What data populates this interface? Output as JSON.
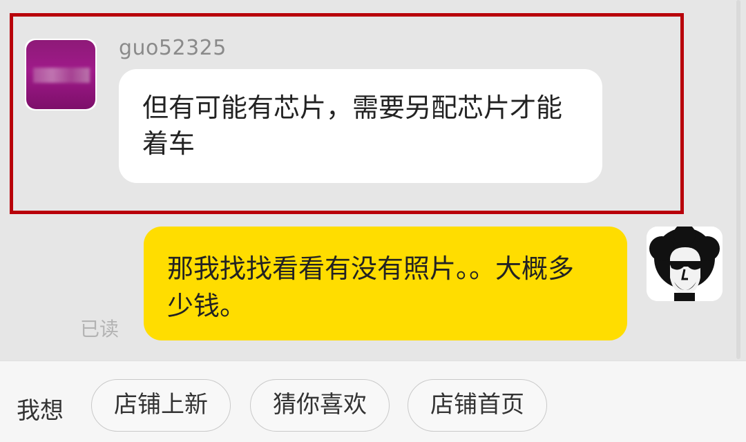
{
  "messages": [
    {
      "direction": "incoming",
      "sender": "guo52325",
      "text": "但有可能有芯片，需要另配芯片才能着车",
      "bubble_color": "#ffffff"
    },
    {
      "direction": "outgoing",
      "text": "那我找找看看有没有照片。。大概多少钱。",
      "status": "已读",
      "bubble_color": "#ffdd00"
    }
  ],
  "highlight_color": "#b8000a",
  "suggestions": {
    "label": "我想",
    "chips": [
      "店铺上新",
      "猜你喜欢",
      "店铺首页"
    ]
  }
}
